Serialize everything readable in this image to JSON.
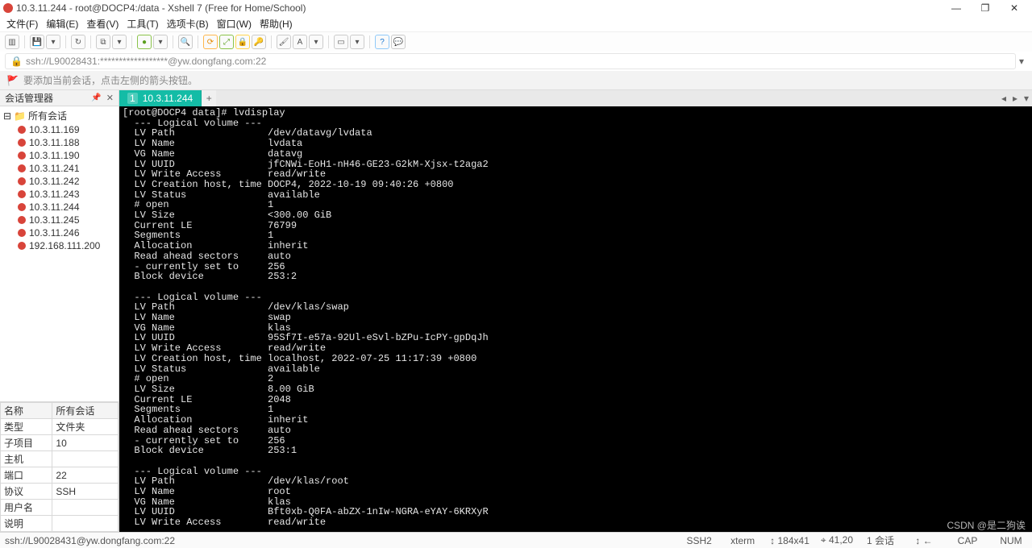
{
  "window": {
    "title": "10.3.11.244 - root@DOCP4:/data - Xshell 7 (Free for Home/School)"
  },
  "window_controls": {
    "min": "—",
    "max": "❐",
    "close": "✕"
  },
  "menu": {
    "file": "文件(F)",
    "edit": "编辑(E)",
    "view": "查看(V)",
    "tools": "工具(T)",
    "tabs": "选项卡(B)",
    "window": "窗口(W)",
    "help": "帮助(H)"
  },
  "address": {
    "text": "ssh://L90028431:******************@yw.dongfang.com:22"
  },
  "hint": {
    "text": "要添加当前会话，点击左侧的箭头按钮。"
  },
  "side_panel": {
    "title": "会话管理器",
    "root": "所有会话",
    "sessions": [
      "10.3.11.169",
      "10.3.11.188",
      "10.3.11.190",
      "10.3.11.241",
      "10.3.11.242",
      "10.3.11.243",
      "10.3.11.244",
      "10.3.11.245",
      "10.3.11.246",
      "192.168.111.200"
    ]
  },
  "properties": {
    "header": {
      "name": "名称",
      "value": "所有会话"
    },
    "rows": [
      {
        "k": "类型",
        "v": "文件夹"
      },
      {
        "k": "子项目",
        "v": "10"
      },
      {
        "k": "主机",
        "v": ""
      },
      {
        "k": "端口",
        "v": "22"
      },
      {
        "k": "协议",
        "v": "SSH"
      },
      {
        "k": "用户名",
        "v": ""
      },
      {
        "k": "说明",
        "v": ""
      }
    ]
  },
  "tab": {
    "num": "1",
    "label": "10.3.11.244",
    "plus": "+"
  },
  "terminal": {
    "prompt": "[root@DOCP4 data]# lvdisplay",
    "lines": [
      "  --- Logical volume ---",
      "  LV Path                /dev/datavg/lvdata",
      "  LV Name                lvdata",
      "  VG Name                datavg",
      "  LV UUID                jfCNWi-EoH1-nH46-GE23-G2kM-Xjsx-t2aga2",
      "  LV Write Access        read/write",
      "  LV Creation host, time DOCP4, 2022-10-19 09:40:26 +0800",
      "  LV Status              available",
      "  # open                 1",
      "  LV Size                <300.00 GiB",
      "  Current LE             76799",
      "  Segments               1",
      "  Allocation             inherit",
      "  Read ahead sectors     auto",
      "  - currently set to     256",
      "  Block device           253:2",
      "",
      "  --- Logical volume ---",
      "  LV Path                /dev/klas/swap",
      "  LV Name                swap",
      "  VG Name                klas",
      "  LV UUID                95Sf7I-e57a-92Ul-eSvl-bZPu-IcPY-gpDqJh",
      "  LV Write Access        read/write",
      "  LV Creation host, time localhost, 2022-07-25 11:17:39 +0800",
      "  LV Status              available",
      "  # open                 2",
      "  LV Size                8.00 GiB",
      "  Current LE             2048",
      "  Segments               1",
      "  Allocation             inherit",
      "  Read ahead sectors     auto",
      "  - currently set to     256",
      "  Block device           253:1",
      "",
      "  --- Logical volume ---",
      "  LV Path                /dev/klas/root",
      "  LV Name                root",
      "  VG Name                klas",
      "  LV UUID                Bft0xb-Q0FA-abZX-1nIw-NGRA-eYAY-6KRXyR",
      "  LV Write Access        read/write"
    ]
  },
  "status": {
    "left": "ssh://L90028431@yw.dongfang.com:22",
    "ssh": "SSH2",
    "term": "xterm",
    "size": "↕ 184x41",
    "cursor": "⌖ 41,20",
    "sess": "1 会话",
    "link": "↕ ←",
    "cap": "CAP",
    "num": "NUM"
  },
  "watermark": "CSDN @是二狗诶"
}
